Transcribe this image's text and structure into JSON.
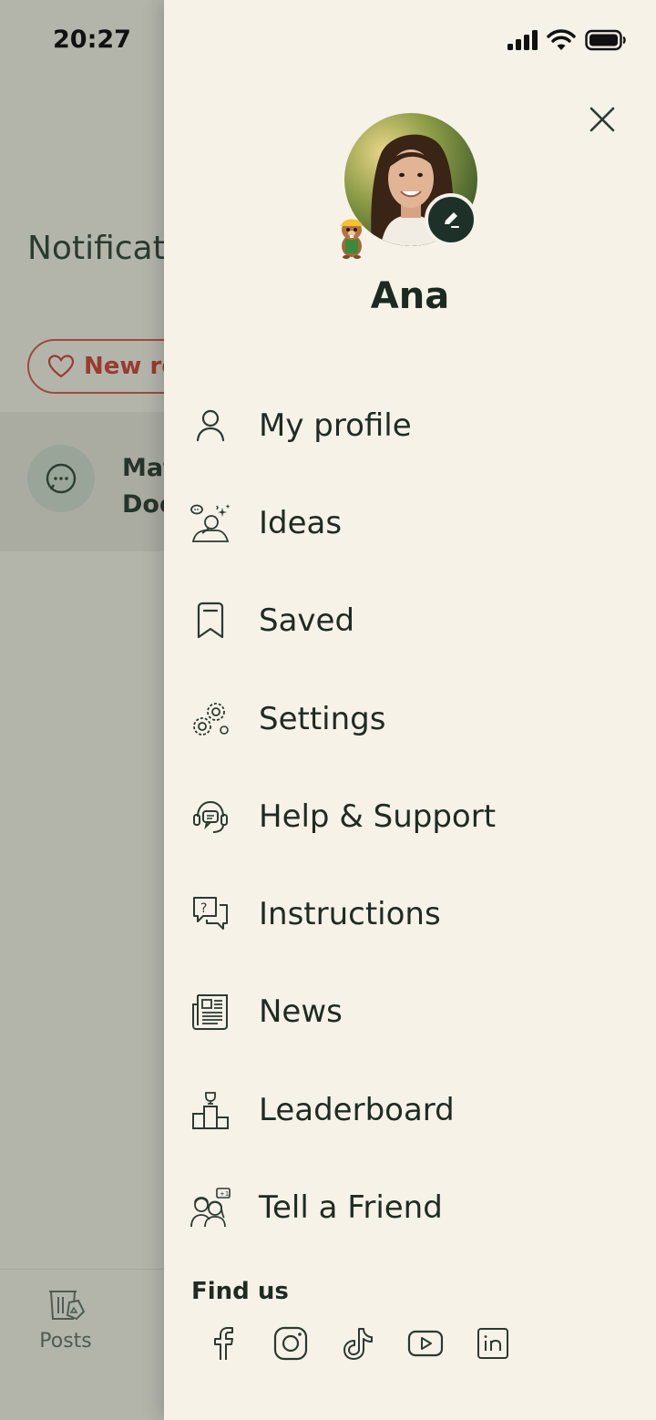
{
  "status_bar": {
    "time": "20:27"
  },
  "background": {
    "title": "Notificati",
    "filter_chip": "New rea",
    "notification": {
      "line1": "Mat",
      "line2": "Doe"
    },
    "bottom_nav": {
      "posts_label": "Posts"
    }
  },
  "drawer": {
    "user_name": "Ana",
    "menu": [
      {
        "label": "My profile",
        "icon": "person-icon"
      },
      {
        "label": "Ideas",
        "icon": "ideas-icon"
      },
      {
        "label": "Saved",
        "icon": "bookmark-icon"
      },
      {
        "label": "Settings",
        "icon": "gear-icon"
      },
      {
        "label": "Help & Support",
        "icon": "headset-icon"
      },
      {
        "label": "Instructions",
        "icon": "question-chat-icon"
      },
      {
        "label": "News",
        "icon": "newspaper-icon"
      },
      {
        "label": "Leaderboard",
        "icon": "podium-icon"
      },
      {
        "label": "Tell a Friend",
        "icon": "friends-icon"
      }
    ],
    "find_us": "Find us",
    "socials": [
      "facebook",
      "instagram",
      "tiktok",
      "youtube",
      "linkedin"
    ]
  },
  "colors": {
    "drawer_bg": "#f6f2e8",
    "text": "#1e2b23",
    "accent_red": "#9a3b30",
    "badge": "#1e3129"
  }
}
